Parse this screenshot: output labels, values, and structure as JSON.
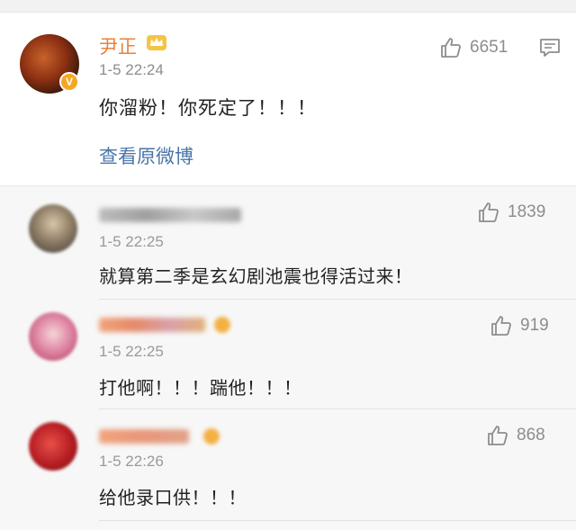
{
  "main": {
    "username": "尹正",
    "timestamp": "1-5 22:24",
    "like_count": "6651",
    "text": "你溜粉！你死定了！！！",
    "view_original": "查看原微博",
    "verified_badge": "V",
    "icons": {
      "crown": "crown-icon",
      "like": "thumbs-up-icon",
      "comment": "comment-icon"
    }
  },
  "replies": [
    {
      "timestamp": "1-5 22:25",
      "like_count": "1839",
      "text": "就算第二季是玄幻剧池震也得活过来！"
    },
    {
      "timestamp": "1-5 22:25",
      "like_count": "919",
      "text": "打他啊！！！踹他！！！"
    },
    {
      "timestamp": "1-5 22:26",
      "like_count": "868",
      "text": "给他录口供！！！"
    }
  ],
  "colors": {
    "username": "#e8813a",
    "link": "#4a76a8",
    "muted": "#8d8d8d",
    "reply_bg": "#f7f7f7",
    "badge": "#f5a623"
  }
}
